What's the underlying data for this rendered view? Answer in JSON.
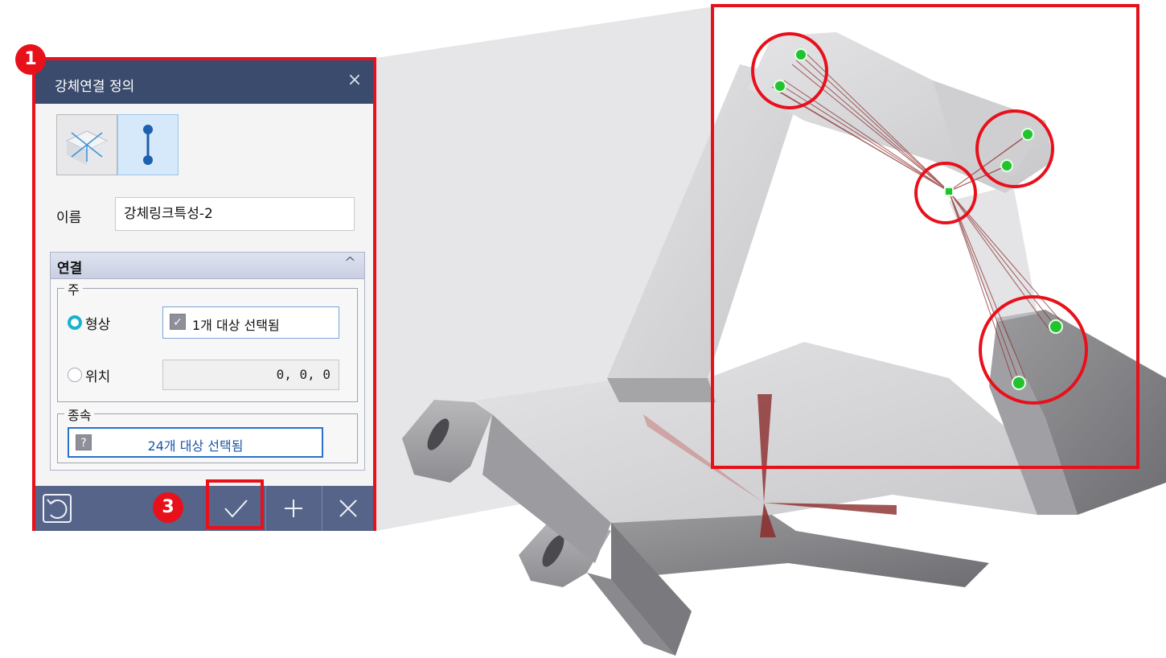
{
  "dialog": {
    "title": "강체연결 정의",
    "name_label": "이름",
    "name_value": "강체링크특성-2",
    "section_title": "연결",
    "main_group_label": "주",
    "shape_option": "형상",
    "position_option": "위치",
    "main_selection_text": "1개 대상 선택됨",
    "position_value": "0, 0, 0",
    "sub_group_label": "종속",
    "sub_selection_text": "24개 대상 선택됨",
    "sub_check_glyph": "?",
    "close_glyph": "×",
    "collapse_glyph": "^"
  },
  "callouts": {
    "badge_1": "1",
    "badge_3": "3"
  },
  "colors": {
    "highlight_red": "#e8101a",
    "titlebar": "#3b4b6d",
    "footer": "#56648a",
    "radio_selected": "#15b3cc",
    "link_lines": "#8b2a2a",
    "node_green": "#22c230"
  },
  "icons": [
    "rigid-spider-icon",
    "rigid-link-icon",
    "reset-icon",
    "confirm-check-icon",
    "add-plus-icon",
    "cancel-x-icon",
    "close-icon",
    "collapse-chevron-icon",
    "checkbox-icon"
  ]
}
